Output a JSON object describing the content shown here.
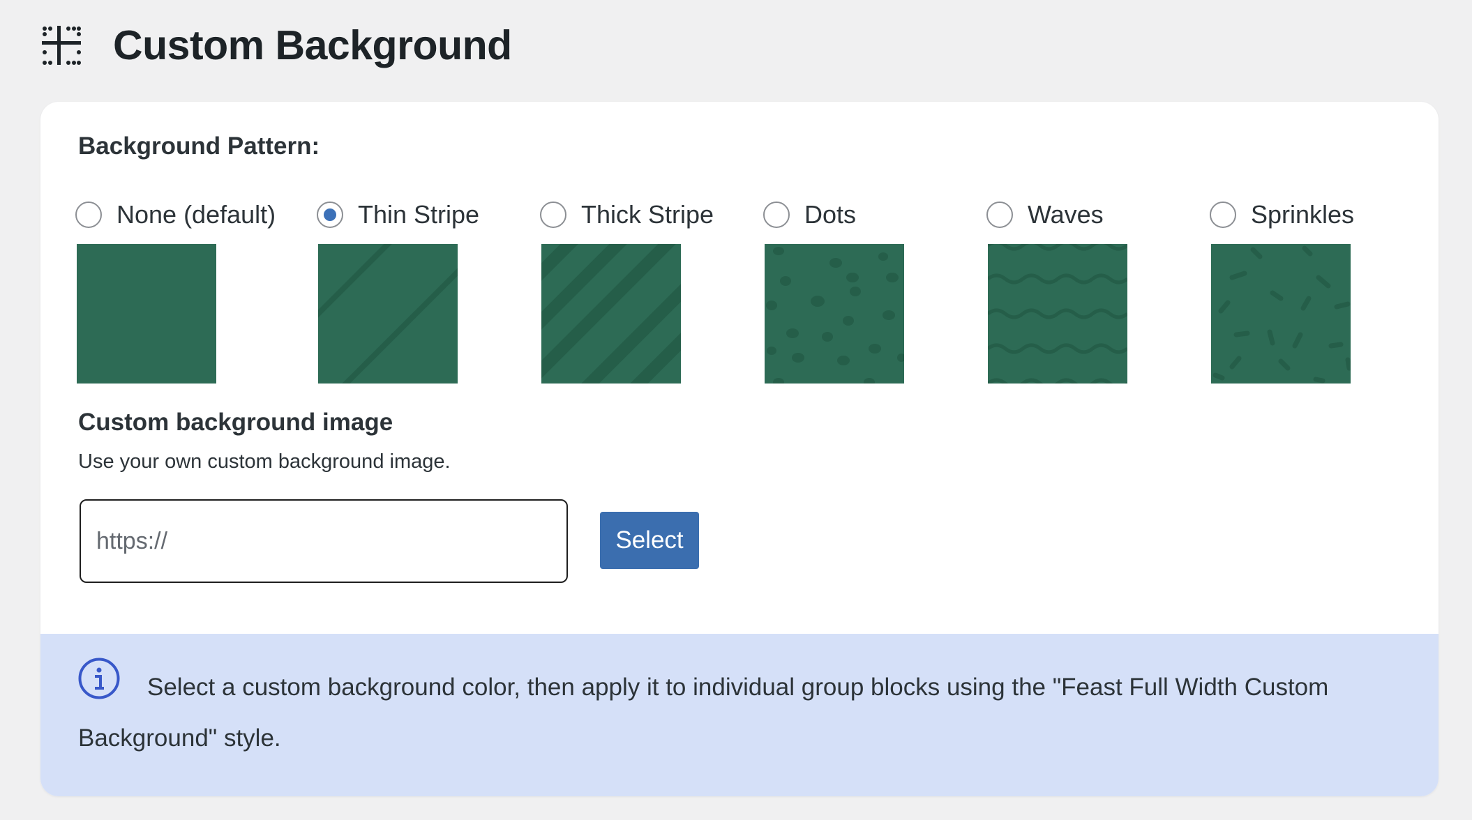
{
  "header": {
    "title": "Custom Background",
    "icon": "grid-layout-icon"
  },
  "pattern_section": {
    "label": "Background Pattern:",
    "selected": "Thin Stripe",
    "swatch_color": "#2d6b55",
    "pattern_color": "#27604c",
    "options": [
      {
        "label": "None (default)",
        "checked": false,
        "pattern": "none"
      },
      {
        "label": "Thin Stripe",
        "checked": true,
        "pattern": "thin-stripe"
      },
      {
        "label": "Thick Stripe",
        "checked": false,
        "pattern": "thick-stripe"
      },
      {
        "label": "Dots",
        "checked": false,
        "pattern": "dots"
      },
      {
        "label": "Waves",
        "checked": false,
        "pattern": "waves"
      },
      {
        "label": "Sprinkles",
        "checked": false,
        "pattern": "sprinkles"
      }
    ]
  },
  "custom_image": {
    "title": "Custom background image",
    "description": "Use your own custom background image.",
    "url_placeholder": "https://",
    "url_value": "",
    "select_label": "Select"
  },
  "notice": {
    "icon": "info-icon",
    "text": "Select a custom background color, then apply it to individual group blocks using the \"Feast Full Width Custom Background\" style.",
    "background_color": "#d5e0f8",
    "icon_color": "#3858c9"
  },
  "colors": {
    "accent": "#3b6eaf",
    "radio_checked": "#3c71b8"
  }
}
